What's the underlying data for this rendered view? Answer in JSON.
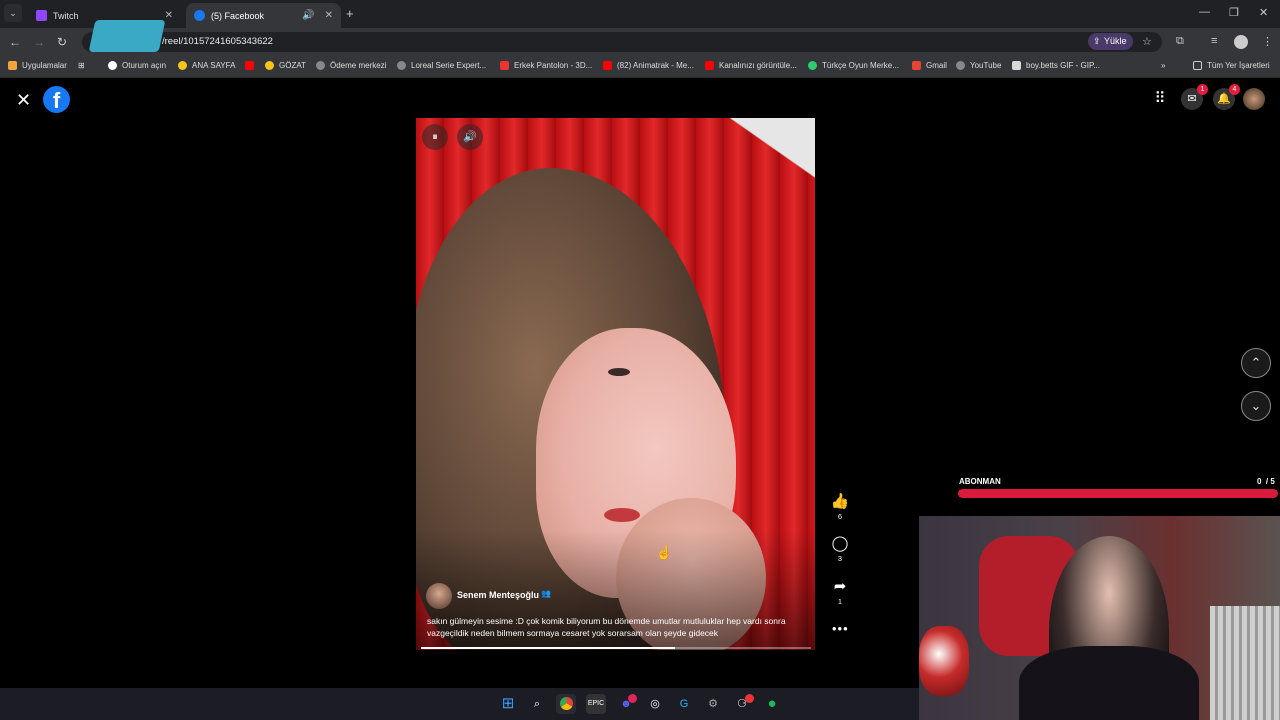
{
  "browser": {
    "tabs": [
      {
        "title": "Twitch",
        "icon": "twitch-icon",
        "color": "#9146ff"
      },
      {
        "title": "(5) Facebook",
        "icon": "facebook-icon",
        "color": "#1877f2"
      }
    ],
    "url": "/reel/10157241605343622",
    "upload_label": "Yükle",
    "bookmarks": [
      "Uygulamalar",
      "Oturum açın",
      "ANA SAYFA",
      "GÖZAT",
      "Ödeme merkezi",
      "Loreal Serie Expert...",
      "Erkek Pantolon - 3D...",
      "(82) Animatrak - Me...",
      "Kanalınızı görüntüle...",
      "Türkçe Oyun Merke...",
      "Gmail",
      "YouTube",
      "boy.betts GIF - GIP...",
      "Tüm Yer İşaretleri"
    ]
  },
  "facebook": {
    "messenger_badge": "1",
    "notifications_badge": "4",
    "reel": {
      "author": "Senem Menteşoğlu",
      "caption": "sakın gülmeyin sesime  :D çok komik biliyorum bu dönemde umutlar mutluluklar hep vardı sonra vazgeçildik neden bilmem sormaya cesaret yok sorarsam olan şeyde gidecek",
      "likes": "6",
      "comments": "3",
      "shares": "1",
      "progress": 0.65
    }
  },
  "overlay": {
    "sub_label": "ABONMAN",
    "sub_count": "0",
    "sub_goal": "/ 5",
    "sub_progress": 1.0,
    "accent": "#d81b3a"
  }
}
